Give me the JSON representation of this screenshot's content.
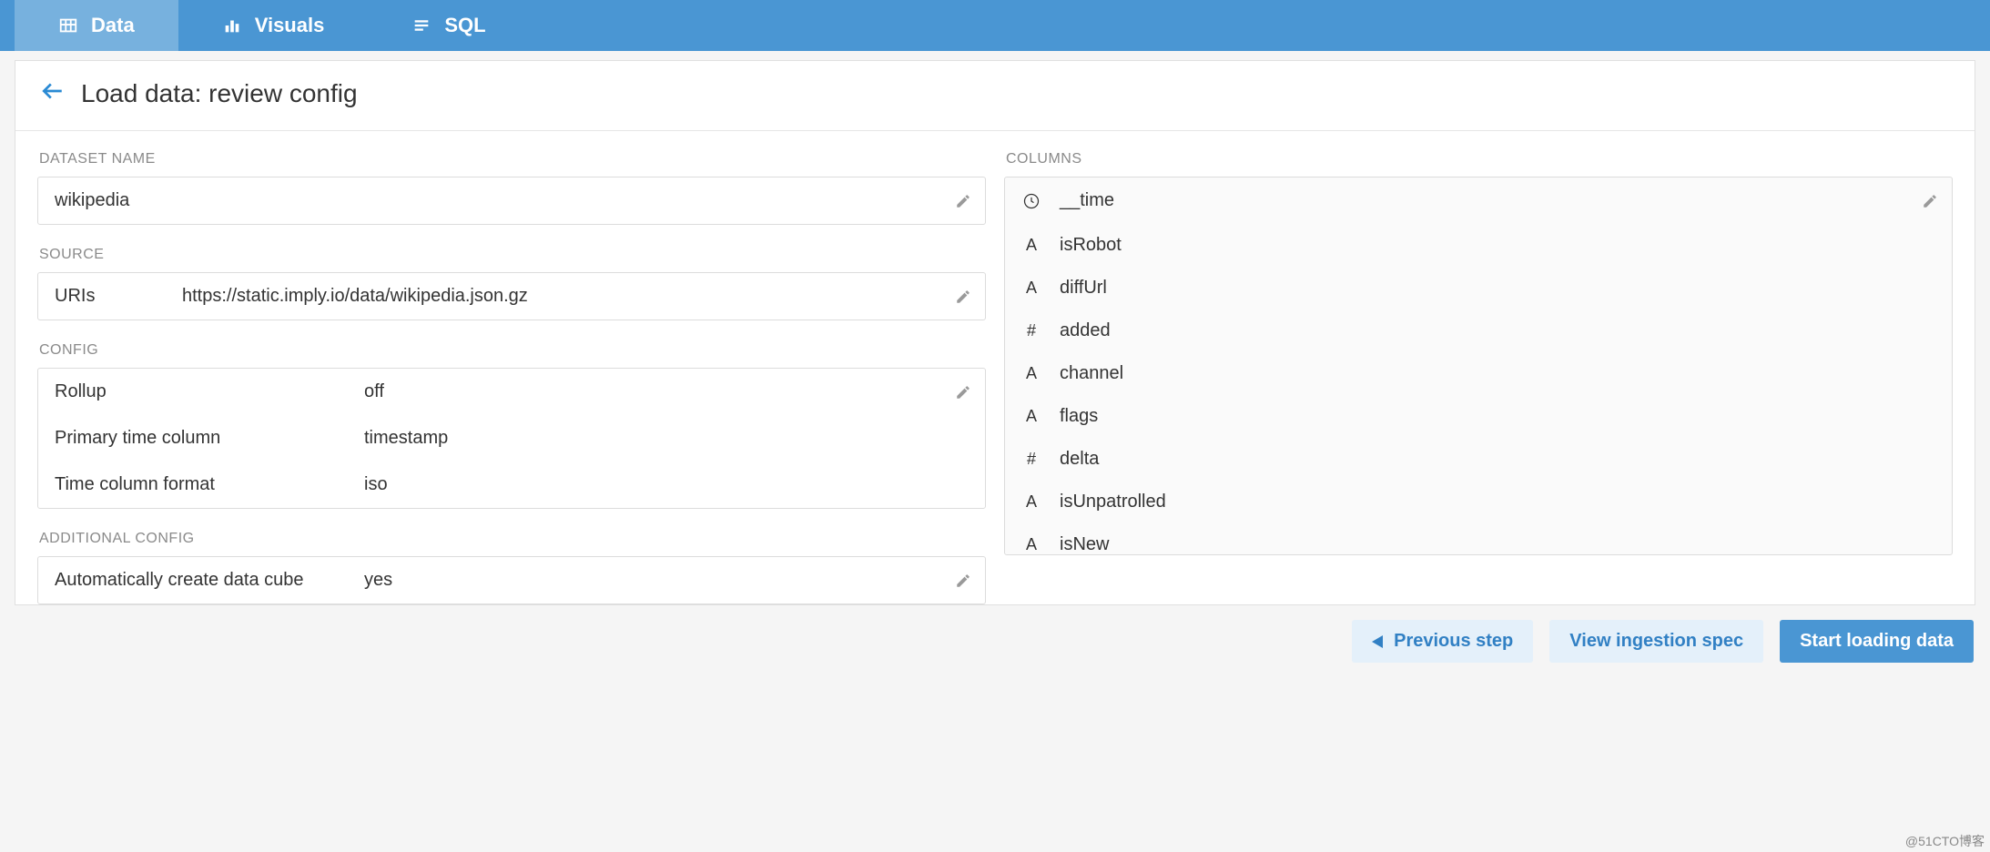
{
  "nav": {
    "tabs": [
      {
        "label": "Data"
      },
      {
        "label": "Visuals"
      },
      {
        "label": "SQL"
      }
    ]
  },
  "header": {
    "title": "Load data: review config"
  },
  "left": {
    "datasetLabel": "DATASET NAME",
    "datasetValue": "wikipedia",
    "sourceLabel": "SOURCE",
    "sourceType": "URIs",
    "sourceValue": "https://static.imply.io/data/wikipedia.json.gz",
    "configLabel": "CONFIG",
    "configRows": [
      {
        "k": "Rollup",
        "v": "off"
      },
      {
        "k": "Primary time column",
        "v": "timestamp"
      },
      {
        "k": "Time column format",
        "v": "iso"
      }
    ],
    "additionalLabel": "ADDITIONAL CONFIG",
    "additionalRows": [
      {
        "k": "Automatically create data cube",
        "v": "yes"
      }
    ]
  },
  "right": {
    "columnsLabel": "COLUMNS",
    "columns": [
      {
        "name": "__time",
        "type": "time"
      },
      {
        "name": "isRobot",
        "type": "string"
      },
      {
        "name": "diffUrl",
        "type": "string"
      },
      {
        "name": "added",
        "type": "number"
      },
      {
        "name": "channel",
        "type": "string"
      },
      {
        "name": "flags",
        "type": "string"
      },
      {
        "name": "delta",
        "type": "number"
      },
      {
        "name": "isUnpatrolled",
        "type": "string"
      },
      {
        "name": "isNew",
        "type": "string"
      }
    ]
  },
  "footer": {
    "prev": "Previous step",
    "viewSpec": "View ingestion spec",
    "start": "Start loading data"
  },
  "watermark": "@51CTO博客"
}
